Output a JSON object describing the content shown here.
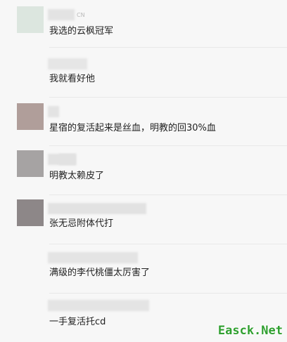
{
  "comments": [
    {
      "badge": "CN",
      "text": "我选的云枫冠军",
      "avatar_color": "#dce6df"
    },
    {
      "badge": "",
      "text": "我就看好他",
      "avatar_color": ""
    },
    {
      "badge": "",
      "text": "星宿的复活起来是丝血，明教的回30%血",
      "avatar_color": "#b09e9a"
    },
    {
      "badge": "",
      "text": "明教太赖皮了",
      "avatar_color": "#a6a3a3"
    },
    {
      "badge": "",
      "text": "张无忌附体代打",
      "avatar_color": "#8d8788"
    },
    {
      "badge": "",
      "text": "满级的李代桃僵太厉害了",
      "avatar_color": ""
    },
    {
      "badge": "",
      "text": "一手复活托cd",
      "avatar_color": ""
    }
  ],
  "watermark": "Easck.Net"
}
